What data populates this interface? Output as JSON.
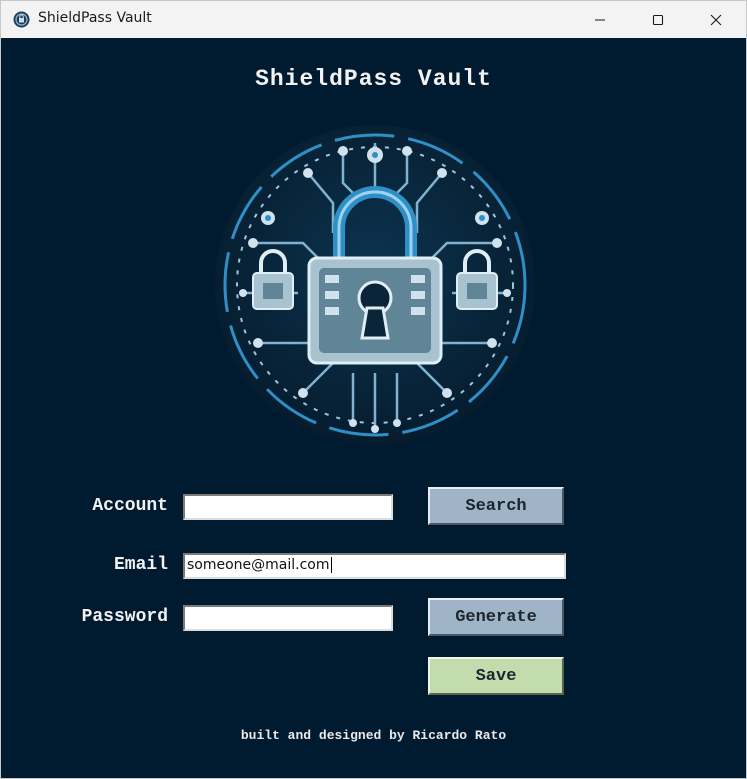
{
  "window": {
    "title": "ShieldPass Vault",
    "app_icon": "app-emblem-icon",
    "controls": [
      "minimize-icon",
      "maximize-icon",
      "close-icon"
    ]
  },
  "header": {
    "title": "ShieldPass Vault"
  },
  "logo": {
    "icon": "circuit-padlock-emblem",
    "accent": "#2f8fc7"
  },
  "form": {
    "account_label": "Account",
    "account_value": "",
    "email_label": "Email",
    "email_value": "someone@mail.com",
    "password_label": "Password",
    "password_value": ""
  },
  "buttons": {
    "search": "Search",
    "generate": "Generate",
    "save": "Save"
  },
  "footer": {
    "credit": "built and designed by Ricardo Rato"
  },
  "colors": {
    "background": "#001b30",
    "button_blue": "#9fb4c6",
    "button_green": "#c2dcae"
  }
}
